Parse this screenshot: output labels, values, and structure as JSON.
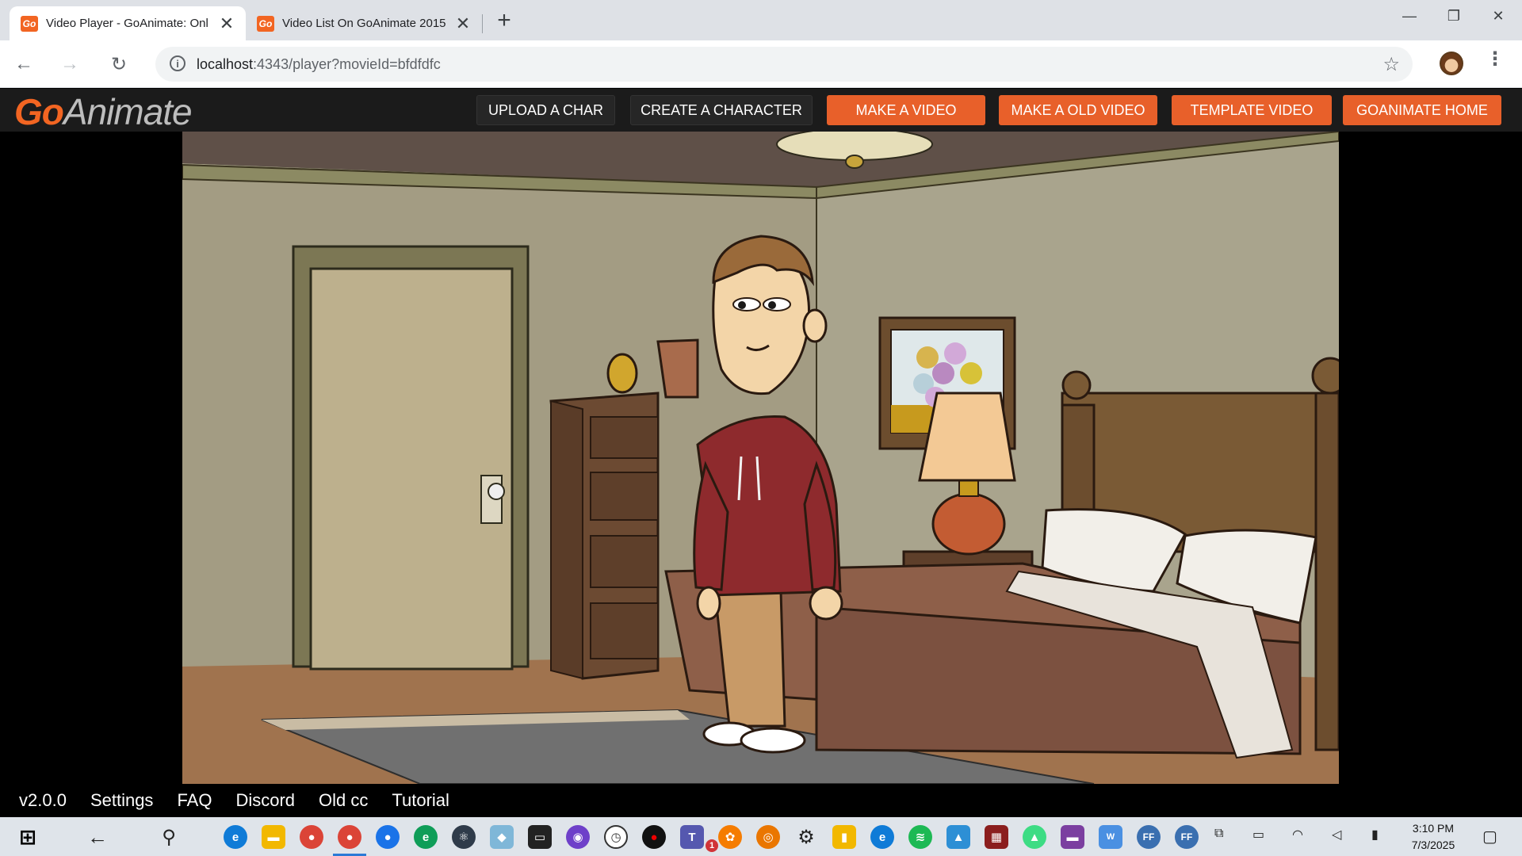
{
  "browser": {
    "tabs": [
      {
        "title": "Video Player - GoAnimate: Onl",
        "favicon": "Go",
        "active": true
      },
      {
        "title": "Video List On GoAnimate 2015",
        "favicon": "Go",
        "active": false
      }
    ],
    "url_host": "localhost",
    "url_rest": ":4343/player?movieId=bfdfdfc"
  },
  "header": {
    "logo_go": "Go",
    "logo_animate": "Animate",
    "nav": [
      {
        "label": "UPLOAD A CHAR",
        "style": "dark"
      },
      {
        "label": "CREATE A CHARACTER",
        "style": "dark"
      },
      {
        "label": "MAKE A VIDEO",
        "style": "orange"
      },
      {
        "label": "MAKE A OLD VIDEO",
        "style": "orange"
      },
      {
        "label": "TEMPLATE VIDEO",
        "style": "orange"
      },
      {
        "label": "GOANIMATE HOME",
        "style": "orange"
      }
    ]
  },
  "footer": {
    "links": [
      "v2.0.0",
      "Settings",
      "FAQ",
      "Discord",
      "Old cc",
      "Tutorial"
    ]
  },
  "taskbar": {
    "time": "3:10 PM",
    "date": "7/3/2025",
    "badge": "1"
  },
  "colors": {
    "brand_orange": "#e8602a",
    "header_bg": "#1b1b1b"
  }
}
